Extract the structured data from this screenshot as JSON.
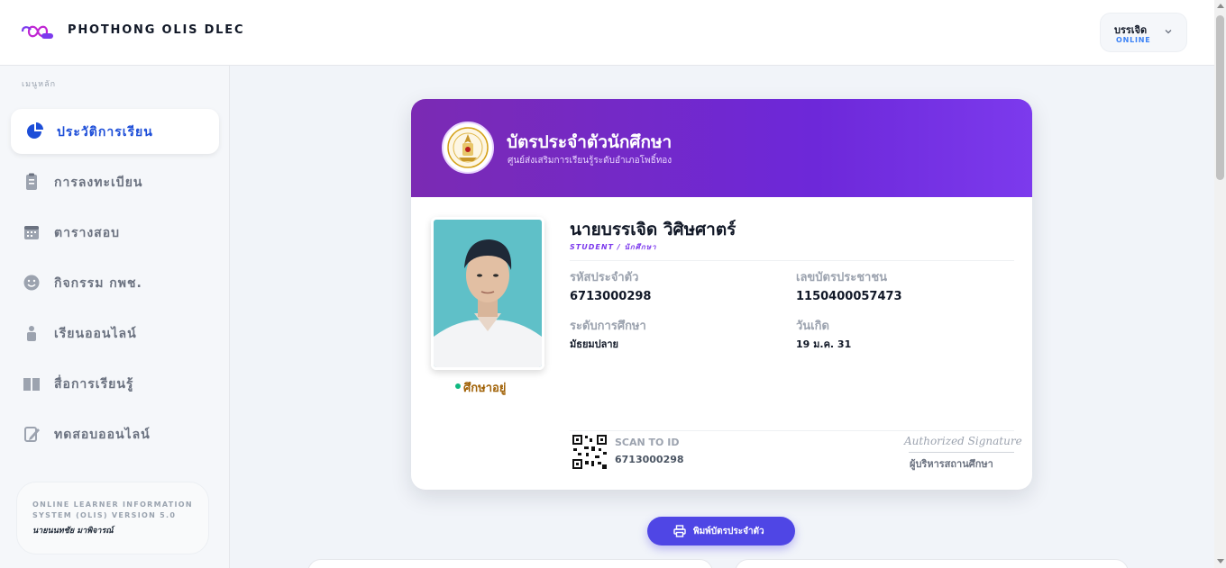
{
  "header": {
    "brand": "PHOTHONG OLIS DLEC",
    "logo_icon": "infinity-logo-icon",
    "user": {
      "name": "บรรเจิด",
      "status": "ONLINE",
      "menu_icon": "chevron-down-icon"
    }
  },
  "sidebar": {
    "heading": "เมนูหลัก",
    "items": [
      {
        "label": "ประวัติการเรียน",
        "icon": "pie-chart-icon",
        "active": true
      },
      {
        "label": "การลงทะเบียน",
        "icon": "clipboard-icon",
        "active": false
      },
      {
        "label": "ตารางสอบ",
        "icon": "calendar-icon",
        "active": false
      },
      {
        "label": "กิจกรรม กพช.",
        "icon": "smile-icon",
        "active": false
      },
      {
        "label": "เรียนออนไลน์",
        "icon": "person-icon",
        "active": false
      },
      {
        "label": "สื่อการเรียนรู้",
        "icon": "book-icon",
        "active": false
      },
      {
        "label": "ทดสอบออนไลน์",
        "icon": "edit-icon",
        "active": false
      }
    ],
    "system_info": {
      "line1": "ONLINE LEARNER INFORMATION",
      "line2": "SYSTEM (OLIS) VERSION 5.0",
      "author": "นายนนทชัย มาพิจารณ์"
    }
  },
  "card": {
    "title": "บัตรประจำตัวนักศึกษา",
    "subtitle": "ศูนย์ส่งเสริมการเรียนรู้ระดับอำเภอโพธิ์ทอง",
    "student": {
      "name": "นายบรรเจิด วิศิษศาตร์",
      "role": "STUDENT / นักศึกษา",
      "status": "ศึกษาอยู่"
    },
    "fields": {
      "student_id_label": "รหัสประจำตัว",
      "student_id": "6713000298",
      "national_id_label": "เลขบัตรประชาชน",
      "national_id": "1150400057473",
      "level_label": "ระดับการศึกษา",
      "level": "มัธยมปลาย",
      "birth_label": "วันเกิด",
      "birth": "19 ม.ค. 31"
    },
    "footer": {
      "scan_label": "SCAN TO ID",
      "scan_id": "6713000298",
      "signature": "Authorized Signature",
      "signature_role": "ผู้บริหารสถานศึกษา"
    }
  },
  "actions": {
    "print_label": "พิมพ์บัตรประจำตัว",
    "print_icon": "printer-icon"
  },
  "colors": {
    "accent": "#4f46e5",
    "card_header": "#6d28d9",
    "active_menu": "#1d4ed8"
  }
}
